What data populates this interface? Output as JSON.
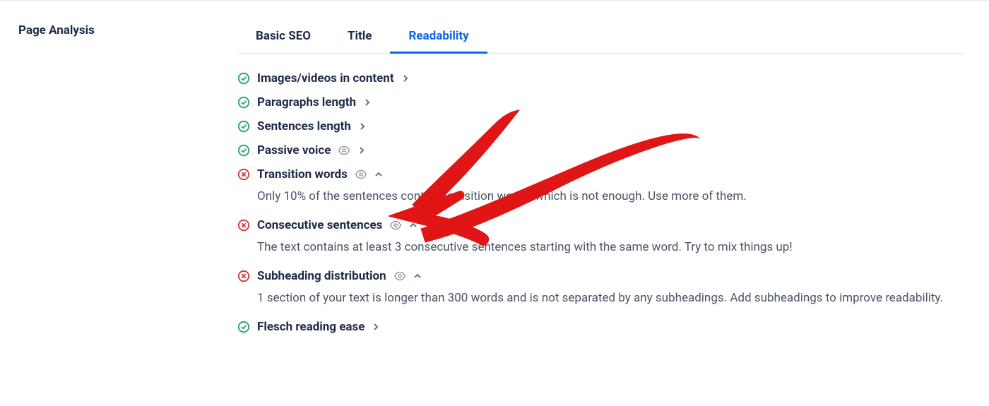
{
  "sidebar": {
    "title": "Page Analysis"
  },
  "tabs": [
    {
      "label": "Basic SEO",
      "active": false
    },
    {
      "label": "Title",
      "active": false
    },
    {
      "label": "Readability",
      "active": true
    }
  ],
  "items": [
    {
      "status": "ok",
      "title": "Images/videos in content",
      "eye": false,
      "expanded": false
    },
    {
      "status": "ok",
      "title": "Paragraphs length",
      "eye": false,
      "expanded": false
    },
    {
      "status": "ok",
      "title": "Sentences length",
      "eye": false,
      "expanded": false
    },
    {
      "status": "ok",
      "title": "Passive voice",
      "eye": true,
      "expanded": false
    },
    {
      "status": "fail",
      "title": "Transition words",
      "eye": true,
      "expanded": true,
      "desc": "Only 10% of the sentences contain transition words, which is not enough. Use more of them."
    },
    {
      "status": "fail",
      "title": "Consecutive sentences",
      "eye": true,
      "expanded": true,
      "desc": "The text contains at least 3 consecutive sentences starting with the same word. Try to mix things up!"
    },
    {
      "status": "fail",
      "title": "Subheading distribution",
      "eye": true,
      "expanded": true,
      "desc": "1 section of your text is longer than 300 words and is not separated by any subheadings. Add subheadings to improve readability."
    },
    {
      "status": "ok",
      "title": "Flesch reading ease",
      "eye": false,
      "expanded": false
    }
  ],
  "annotation_color": "#e01515"
}
